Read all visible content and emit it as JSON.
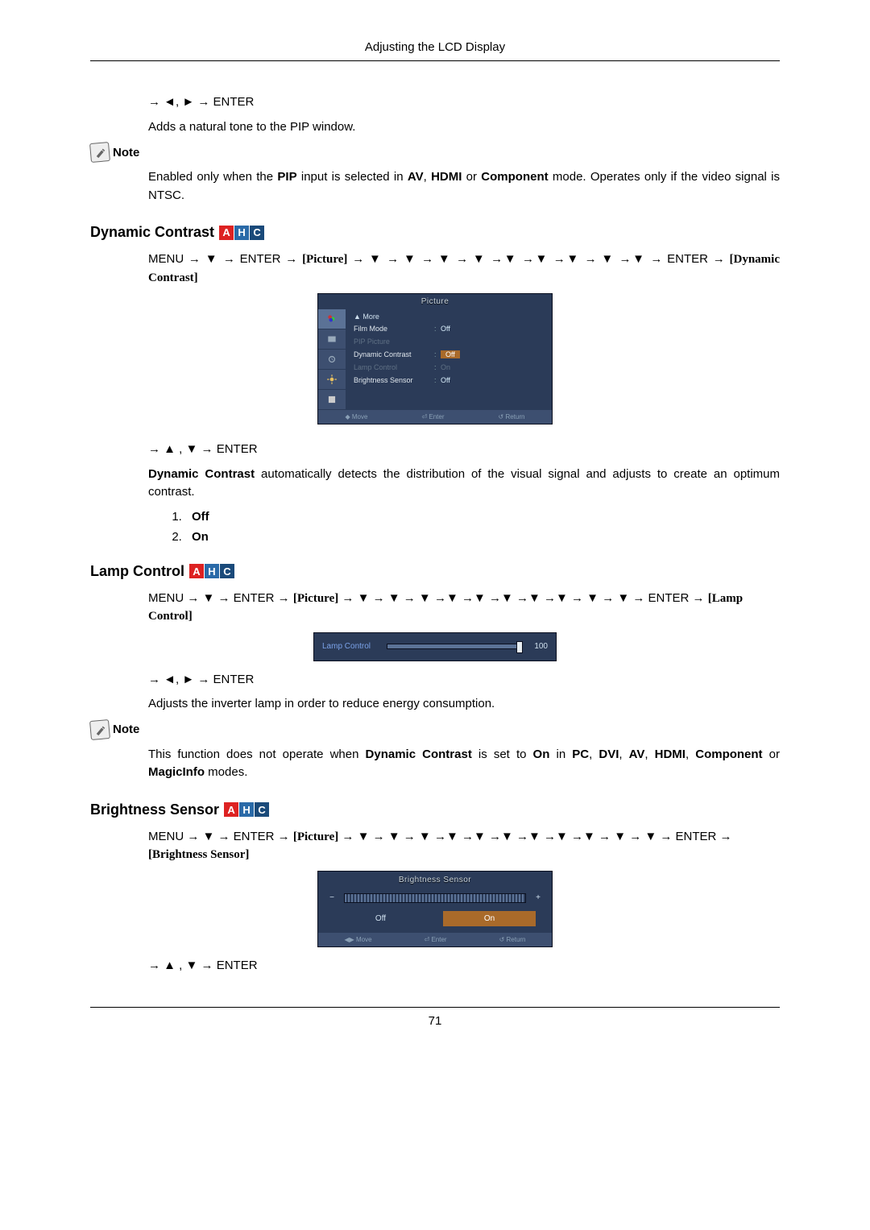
{
  "header": "Adjusting the LCD Display",
  "page_number": "71",
  "badges": {
    "a": "A",
    "h": "H",
    "c": "C"
  },
  "intro": {
    "nav": "→ ◄, ► → ENTER",
    "desc": "Adds a natural tone to the PIP window.",
    "note_label": "Note",
    "note_prefix": "Enabled only when the ",
    "note_b1": "PIP",
    "note_mid1": " input is selected in ",
    "note_b2": "AV",
    "note_sep1": ", ",
    "note_b3": "HDMI",
    "note_sep2": " or ",
    "note_b4": "Component",
    "note_suffix": " mode. Operates only if the video signal is NTSC."
  },
  "dynamic_contrast": {
    "title": "Dynamic Contrast",
    "nav1_pre": "MENU → ▼ → ENTER → ",
    "nav1_pic": "[Picture]",
    "nav1_post": " → ▼ → ▼ → ▼ → ▼ →▼ →▼ →▼ → ▼ →▼ → ENTER → ",
    "nav1_target": "[Dynamic Contrast]",
    "osd": {
      "title": "Picture",
      "more": "▲ More",
      "rows": [
        {
          "label": "Film Mode",
          "value": "Off",
          "state": "normal"
        },
        {
          "label": "PIP Picture",
          "value": "",
          "state": "dim"
        },
        {
          "label": "Dynamic Contrast",
          "value": "Off",
          "state": "hi"
        },
        {
          "label": "Lamp Control",
          "value": "On",
          "state": "dim"
        },
        {
          "label": "Brightness Sensor",
          "value": "Off",
          "state": "normal"
        }
      ],
      "footer": [
        "◆ Move",
        "⏎ Enter",
        "↺ Return"
      ]
    },
    "nav2": "→ ▲ , ▼ → ENTER",
    "desc_b": "Dynamic Contrast",
    "desc_rest": " automatically detects the distribution of the visual signal and adjusts to create an optimum contrast.",
    "options": [
      "Off",
      "On"
    ]
  },
  "lamp_control": {
    "title": "Lamp Control",
    "nav1_pre": "MENU → ▼ → ENTER → ",
    "nav1_pic": "[Picture]",
    "nav1_post": " → ▼ → ▼ → ▼ →▼ →▼ →▼ →▼ →▼ → ▼ → ▼ → ENTER → ",
    "nav1_target": "[Lamp Control]",
    "osd": {
      "label": "Lamp Control",
      "value": "100"
    },
    "nav2": "→ ◄, ► → ENTER",
    "desc": "Adjusts the inverter lamp in order to reduce energy consumption.",
    "note_label": "Note",
    "note_prefix": "This function does not operate when ",
    "note_b1": "Dynamic Contrast",
    "note_mid1": " is set to ",
    "note_b2": "On",
    "note_mid2": " in ",
    "note_b3": "PC",
    "note_s1": ", ",
    "note_b4": "DVI",
    "note_s2": ", ",
    "note_b5": "AV",
    "note_s3": ", ",
    "note_b6": "HDMI",
    "note_s4": ", ",
    "note_b7": "Component",
    "note_s5": " or ",
    "note_b8": "MagicInfo",
    "note_suffix": " modes."
  },
  "brightness_sensor": {
    "title": "Brightness Sensor",
    "nav1_pre": "MENU → ▼ → ENTER → ",
    "nav1_pic": "[Picture]",
    "nav1_post": " → ▼ → ▼ → ▼ →▼ →▼ →▼ →▼ →▼ →▼ → ▼ → ▼ → ENTER → ",
    "nav1_target": "[Brightness Sensor]",
    "osd": {
      "title": "Brightness Sensor",
      "minus": "−",
      "plus": "+",
      "buttons": [
        "Off",
        "On"
      ],
      "footer": [
        "◀▶ Move",
        "⏎ Enter",
        "↺ Return"
      ]
    },
    "nav2": "→ ▲ , ▼ → ENTER"
  }
}
